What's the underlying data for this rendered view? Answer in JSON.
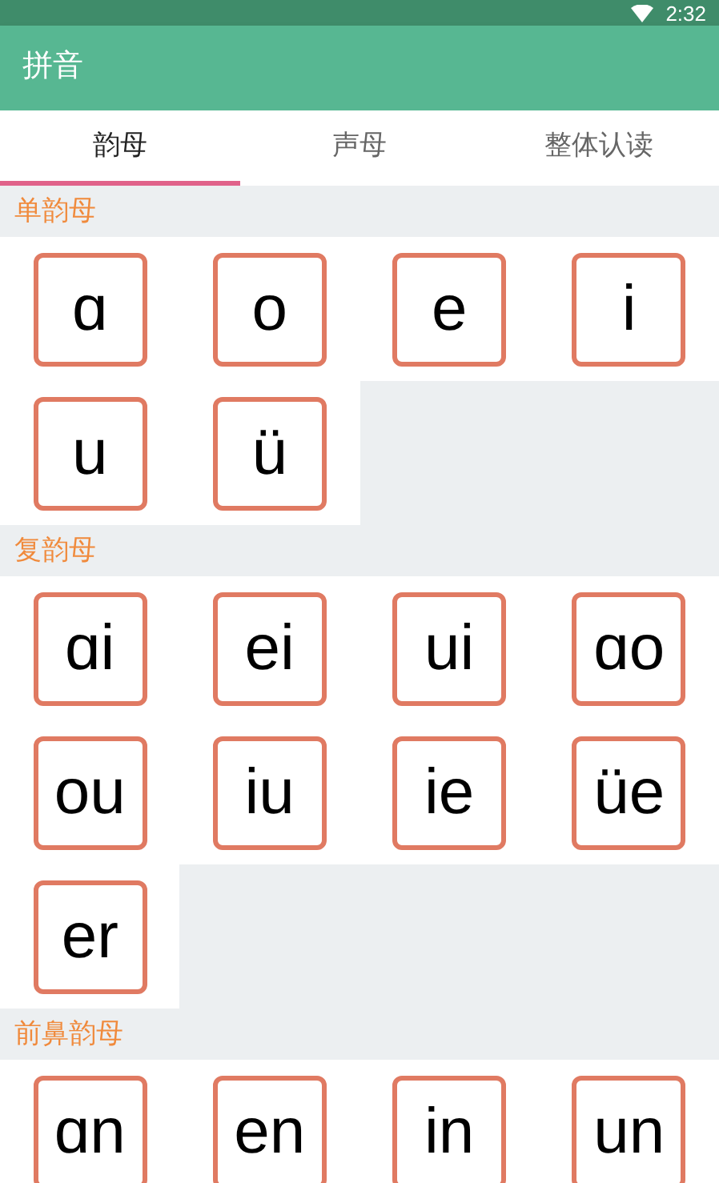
{
  "status_bar": {
    "time": "2:32"
  },
  "app_bar": {
    "title": "拼音"
  },
  "tabs": [
    {
      "label": "韵母",
      "selected": true
    },
    {
      "label": "声母",
      "selected": false
    },
    {
      "label": "整体认读",
      "selected": false
    }
  ],
  "sections": [
    {
      "title": "单韵母",
      "items": [
        "ɑ",
        "o",
        "e",
        "i",
        "u",
        "ü"
      ]
    },
    {
      "title": "复韵母",
      "items": [
        "ɑi",
        "ei",
        "ui",
        "ɑo",
        "ou",
        "iu",
        "ie",
        "üe",
        "er"
      ]
    },
    {
      "title": "前鼻韵母",
      "items": [
        "ɑn",
        "en",
        "in",
        "un"
      ]
    }
  ]
}
